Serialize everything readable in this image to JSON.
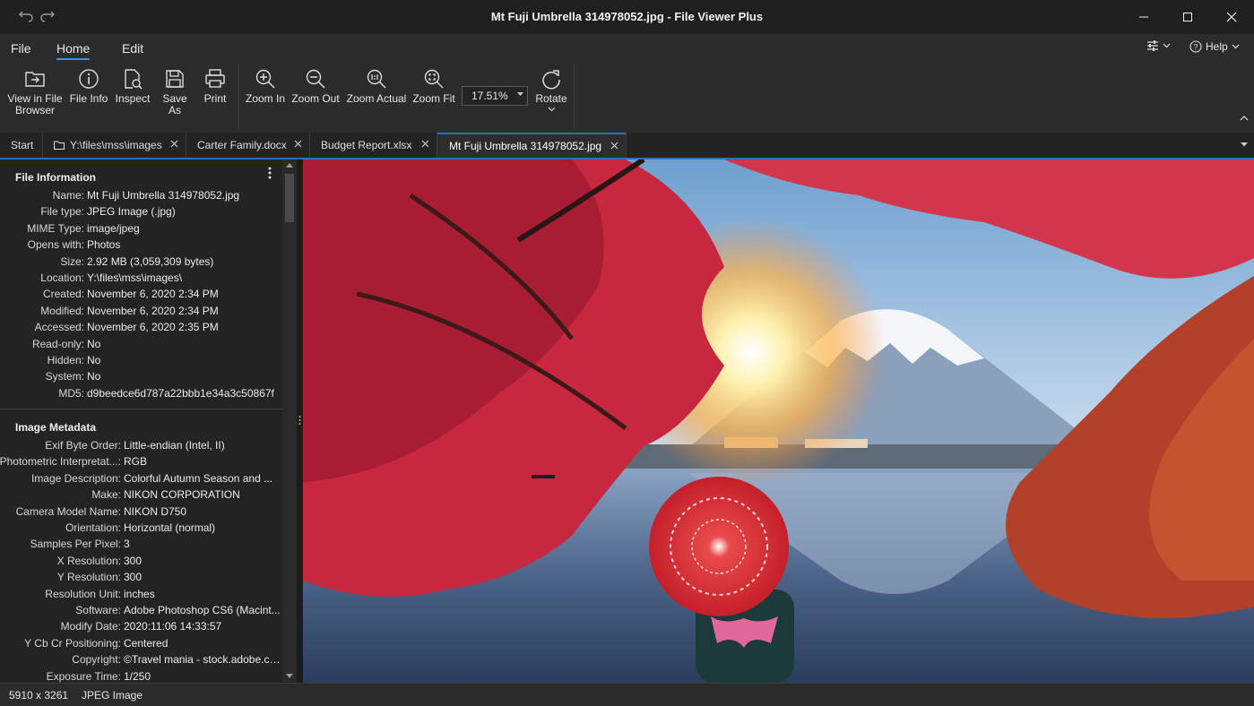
{
  "window": {
    "title": "Mt Fuji Umbrella 314978052.jpg - File Viewer Plus",
    "controls": [
      "undo-icon",
      "redo-icon",
      "minimize-icon",
      "maximize-icon",
      "close-icon"
    ]
  },
  "menu": {
    "items": [
      "File",
      "Home",
      "Edit"
    ],
    "active": "Home",
    "settings_icon": "sliders-icon",
    "help_label": "Help"
  },
  "ribbon": {
    "buttons": [
      {
        "label": "View in File Browser",
        "line1": "View in File",
        "line2": "Browser",
        "icon": "folder-arrow-icon"
      },
      {
        "label": "File Info",
        "icon": "info-icon"
      },
      {
        "label": "Inspect",
        "icon": "inspect-icon"
      },
      {
        "label": "Save As",
        "icon": "save-icon"
      },
      {
        "label": "Print",
        "icon": "print-icon"
      },
      {
        "label": "Zoom In",
        "icon": "zoom-in-icon"
      },
      {
        "label": "Zoom Out",
        "icon": "zoom-out-icon"
      },
      {
        "label": "Zoom Actual",
        "icon": "zoom-actual-icon"
      },
      {
        "label": "Zoom Fit",
        "icon": "zoom-fit-icon"
      },
      {
        "label": "Rotate",
        "icon": "rotate-icon"
      }
    ],
    "zoom_value": "17.51%"
  },
  "tabs": [
    {
      "label": "Start",
      "closable": false
    },
    {
      "label": "Y:\\files\\mss\\images",
      "closable": true,
      "icon": "folder-icon"
    },
    {
      "label": "Carter Family.docx",
      "closable": true
    },
    {
      "label": "Budget Report.xlsx",
      "closable": true
    },
    {
      "label": "Mt Fuji Umbrella 314978052.jpg",
      "closable": true,
      "active": true
    }
  ],
  "file_info": {
    "title": "File Information",
    "rows": [
      {
        "k": "Name:",
        "v": "Mt Fuji Umbrella 314978052.jpg"
      },
      {
        "k": "File type:",
        "v": "JPEG Image (.jpg)"
      },
      {
        "k": "MIME Type:",
        "v": "image/jpeg"
      },
      {
        "k": "Opens with:",
        "v": "Photos"
      },
      {
        "k": "Size:",
        "v": "2.92 MB (3,059,309 bytes)"
      },
      {
        "k": "Location:",
        "v": "Y:\\files\\mss\\images\\"
      },
      {
        "k": "Created:",
        "v": "November 6, 2020 2:34 PM"
      },
      {
        "k": "Modified:",
        "v": "November 6, 2020 2:34 PM"
      },
      {
        "k": "Accessed:",
        "v": "November 6, 2020 2:35 PM"
      },
      {
        "k": "Read-only:",
        "v": "No"
      },
      {
        "k": "Hidden:",
        "v": "No"
      },
      {
        "k": "System:",
        "v": "No"
      },
      {
        "k": "MD5:",
        "v": "d9beedce6d787a22bbb1e34a3c50867f"
      }
    ]
  },
  "image_metadata": {
    "title": "Image Metadata",
    "rows": [
      {
        "k": "Exif Byte Order:",
        "v": "Little-endian (Intel, II)"
      },
      {
        "k": "Photometric Interpretat...:",
        "v": "RGB"
      },
      {
        "k": "Image Description:",
        "v": "Colorful Autumn Season and ..."
      },
      {
        "k": "Make:",
        "v": "NIKON CORPORATION"
      },
      {
        "k": "Camera Model Name:",
        "v": "NIKON D750"
      },
      {
        "k": "Orientation:",
        "v": "Horizontal (normal)"
      },
      {
        "k": "Samples Per Pixel:",
        "v": "3"
      },
      {
        "k": "X Resolution:",
        "v": "300"
      },
      {
        "k": "Y Resolution:",
        "v": "300"
      },
      {
        "k": "Resolution Unit:",
        "v": "inches"
      },
      {
        "k": "Software:",
        "v": "Adobe Photoshop CS6 (Macint..."
      },
      {
        "k": "Modify Date:",
        "v": "2020:11:06 14:33:57"
      },
      {
        "k": "Y Cb Cr Positioning:",
        "v": "Centered"
      },
      {
        "k": "Copyright:",
        "v": "©Travel mania - stock.adobe.com"
      },
      {
        "k": "Exposure Time:",
        "v": "1/250"
      }
    ]
  },
  "status": {
    "dimensions": "5910 x 3261",
    "type": "JPEG Image"
  },
  "colors": {
    "accent": "#3d8fe0",
    "background": "#1e1e1e",
    "panel": "#2b2b2b"
  }
}
